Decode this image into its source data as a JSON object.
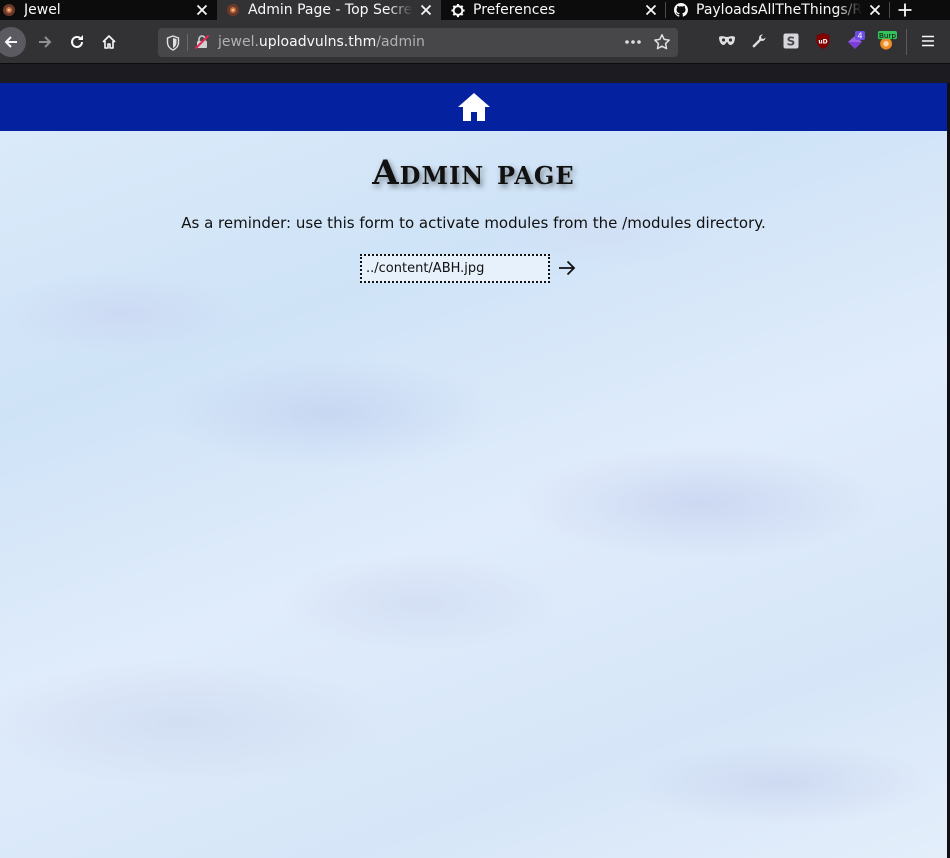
{
  "browser": {
    "tabs": [
      {
        "title": "Jewel",
        "favicon": "jewel-favicon-icon",
        "active": false
      },
      {
        "title": "Admin Page - Top Secret!",
        "favicon": "jewel-favicon-icon",
        "active": true
      },
      {
        "title": "Preferences",
        "favicon": "gear-icon",
        "active": false
      },
      {
        "title": "PayloadsAllTheThings/Re",
        "favicon": "github-icon",
        "active": false
      }
    ],
    "url": {
      "prefix": "jewel.",
      "host": "uploadvulns.thm",
      "path": "/admin"
    },
    "extensions": [
      {
        "name": "mask-icon"
      },
      {
        "name": "wrench-icon"
      },
      {
        "name": "s-extension-icon",
        "label": "S"
      },
      {
        "name": "ublock-icon",
        "label": "uD"
      },
      {
        "name": "purple-gem-icon",
        "badge": "4"
      },
      {
        "name": "burp-icon",
        "badge": "Burp"
      }
    ]
  },
  "page": {
    "heading": "Admin page",
    "reminder": "As a reminder: use this form to activate modules from the /modules directory.",
    "module_input_value": "../content/ABH.jpg"
  },
  "colors": {
    "site_nav": "#0422a0",
    "tab_strip": "#0c0c0d",
    "toolbar": "#323234"
  }
}
